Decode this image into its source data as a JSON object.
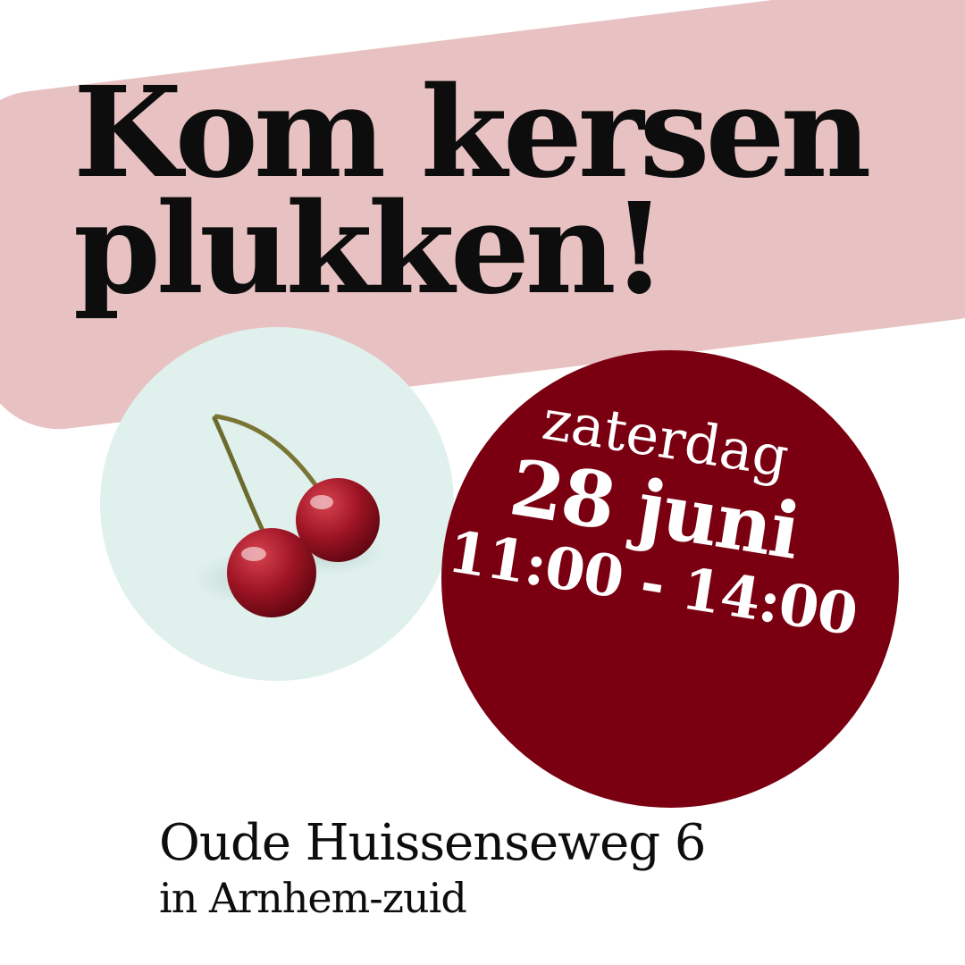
{
  "headline": {
    "line1": "Kom kersen",
    "line2": "plukken!"
  },
  "event": {
    "day": "zaterdag",
    "date": "28 juni",
    "time": "11:00 - 14:00"
  },
  "address": {
    "street": "Oude Huissenseweg 6",
    "city": "in Arnhem-zuid"
  },
  "image": {
    "icon": "cherries-icon"
  },
  "colors": {
    "pink_band": "#e8c2c2",
    "date_circle": "#7a0011",
    "image_circle": "#dff0ed",
    "text": "#0d0d0d"
  }
}
